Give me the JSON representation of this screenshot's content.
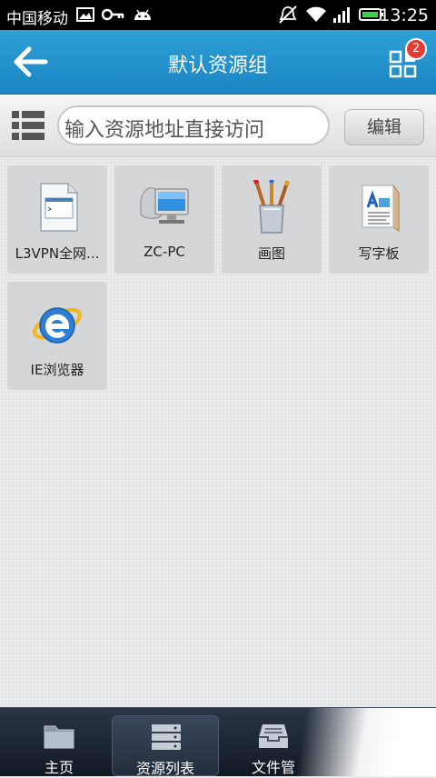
{
  "status_bar": {
    "carrier": "中国移动",
    "time": "13:25",
    "icons": [
      "image-icon",
      "key-icon",
      "android-icon",
      "mute-icon",
      "wifi-icon",
      "signal-icon",
      "battery-icon"
    ]
  },
  "header": {
    "title": "默认资源组",
    "badge_count": "2",
    "colors": {
      "bar": "#1f8fca",
      "badge": "#e53b30"
    }
  },
  "search": {
    "placeholder": "输入资源地址直接访问",
    "edit_label": "编辑"
  },
  "resources": [
    {
      "label": "L3VPN全网...",
      "icon": "window-app-icon"
    },
    {
      "label": "ZC-PC",
      "icon": "remote-computer-icon"
    },
    {
      "label": "画图",
      "icon": "paint-brushes-icon"
    },
    {
      "label": "写字板",
      "icon": "wordpad-icon"
    },
    {
      "label": "IE浏览器",
      "icon": "ie-browser-icon"
    }
  ],
  "bottom_nav": {
    "items": [
      {
        "label": "主页",
        "icon": "folder-home-icon"
      },
      {
        "label": "资源列表",
        "icon": "server-list-icon",
        "active": true
      },
      {
        "label": "文件管",
        "icon": "file-tray-icon"
      }
    ]
  }
}
